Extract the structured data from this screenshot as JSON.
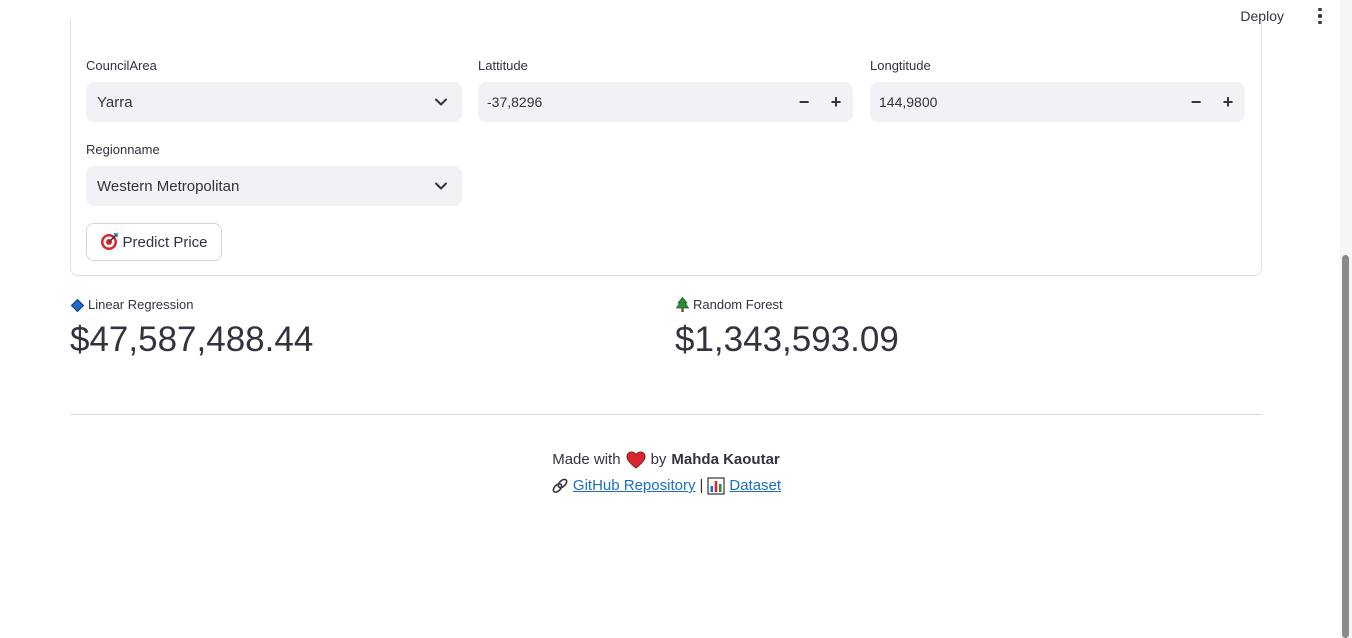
{
  "header": {
    "deploy_label": "Deploy"
  },
  "form": {
    "council_area": {
      "label": "CouncilArea",
      "value": "Yarra"
    },
    "latitude": {
      "label": "Lattitude",
      "value": "-37,8296"
    },
    "longitude": {
      "label": "Longtitude",
      "value": "144,9800"
    },
    "region": {
      "label": "Regionname",
      "value": "Western Metropolitan"
    },
    "predict_button": "Predict Price",
    "minus": "−",
    "plus": "+"
  },
  "results": {
    "linear": {
      "label": "Linear Regression",
      "value": "$47,587,488.44"
    },
    "forest": {
      "label": "Random Forest",
      "value": "$1,343,593.09"
    }
  },
  "footer": {
    "made_with": "Made with",
    "by": "by",
    "author": "Mahda Kaoutar",
    "github": "GitHub Repository",
    "separator": "|",
    "dataset": "Dataset"
  },
  "colors": {
    "heart": "#d9262f",
    "diamond": "#1c6ec7",
    "tree": "#2e8b3a",
    "link": "#1c6ec7"
  },
  "icons": [
    "kebab-menu-icon",
    "chevron-down-icon",
    "target-icon",
    "diamond-icon",
    "tree-icon",
    "heart-icon",
    "link-icon",
    "bar-chart-icon"
  ]
}
